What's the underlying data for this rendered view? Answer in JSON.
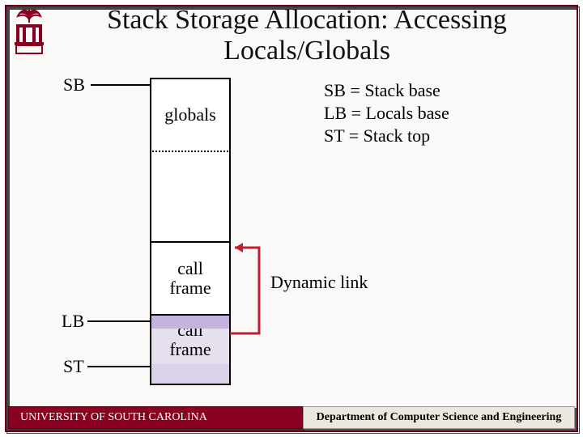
{
  "title": "Stack Storage Allocation: Accessing Locals/Globals",
  "pointers": {
    "sb": "SB",
    "lb": "LB",
    "st": "ST"
  },
  "stack": {
    "globals": "globals",
    "gap": "",
    "frame1": "call\nframe",
    "frame2": "call\nframe"
  },
  "legend": {
    "line1": "SB = Stack base",
    "line2": "LB = Locals base",
    "line3": "ST = Stack top"
  },
  "dynamic_link_label": "Dynamic link",
  "footer": {
    "left": "UNIVERSITY OF SOUTH CAROLINA",
    "right": "Department of Computer Science and Engineering"
  }
}
